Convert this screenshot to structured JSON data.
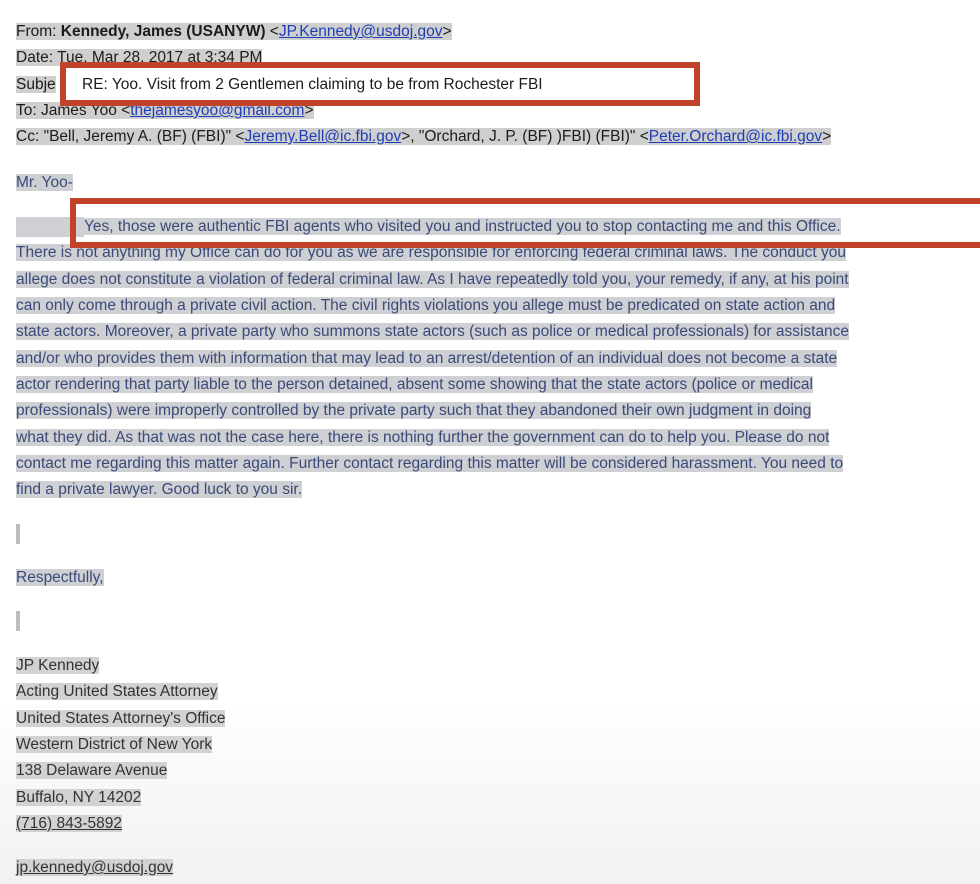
{
  "header": {
    "from_label": "From:",
    "from_name": "Kennedy, James (USANYW)",
    "from_email": "JP.Kennedy@usdoj.gov",
    "date_label": "Date:",
    "date_value": "Tue, Mar 28, 2017 at 3:34 PM",
    "subject_label": "Subje",
    "subject_value": "RE: Yoo. Visit from 2 Gentlemen claiming to be from Rochester FBI",
    "to_label": "To:",
    "to_name": "James Yoo",
    "to_email": "thejamesyoo@gmail.com",
    "cc_label": "Cc:",
    "cc_name_1": "\"Bell, Jeremy A. (BF) (FBI)\"",
    "cc_email_1": "Jeremy.Bell@ic.fbi.gov",
    "cc_name_2": "\"Orchard, J. P. (BF) )FBI) (FBI)\"",
    "cc_email_2": "Peter.Orchard@ic.fbi.gov"
  },
  "body": {
    "greeting": "Mr. Yoo-",
    "lines": [
      "Yes, those were authentic FBI agents who visited you and instructed you to stop contacting me and this Office.",
      "There is not anything my Office can do for you as we are responsible for enforcing federal criminal laws.  The conduct you",
      "allege does not constitute a violation of federal criminal law.  As I have repeatedly told you, your remedy, if any, at his point",
      "can only come through a private civil action.  The civil rights violations you allege must be predicated on state action and",
      "state actors. Moreover, a private party who summons state actors (such as police or medical professionals) for assistance",
      "and/or who provides them with information that may lead to an arrest/detention of an individual does not become a state",
      "actor rendering that party liable to the person detained, absent some showing that the state actors (police or medical",
      "professionals) were improperly controlled by the private party such that they abandoned their own judgment in doing",
      "what they did.  As that was not the case here, there is nothing further the government can do to help you.  Please do not",
      "contact me regarding this matter again.  Further contact regarding this matter will be considered harassment.  You need to",
      "find a private lawyer.  Good luck to you sir."
    ],
    "closing": "Respectfully,"
  },
  "signature": {
    "name": "JP Kennedy",
    "title": "Acting United States Attorney",
    "office": "United States Attorney's Office",
    "district": "Western District of New York",
    "street": "138 Delaware Avenue",
    "city": "Buffalo, NY  14202",
    "phone": "(716) 843-5892",
    "email": "jp.kennedy@usdoj.gov"
  },
  "annotation_color": "#c2432a"
}
